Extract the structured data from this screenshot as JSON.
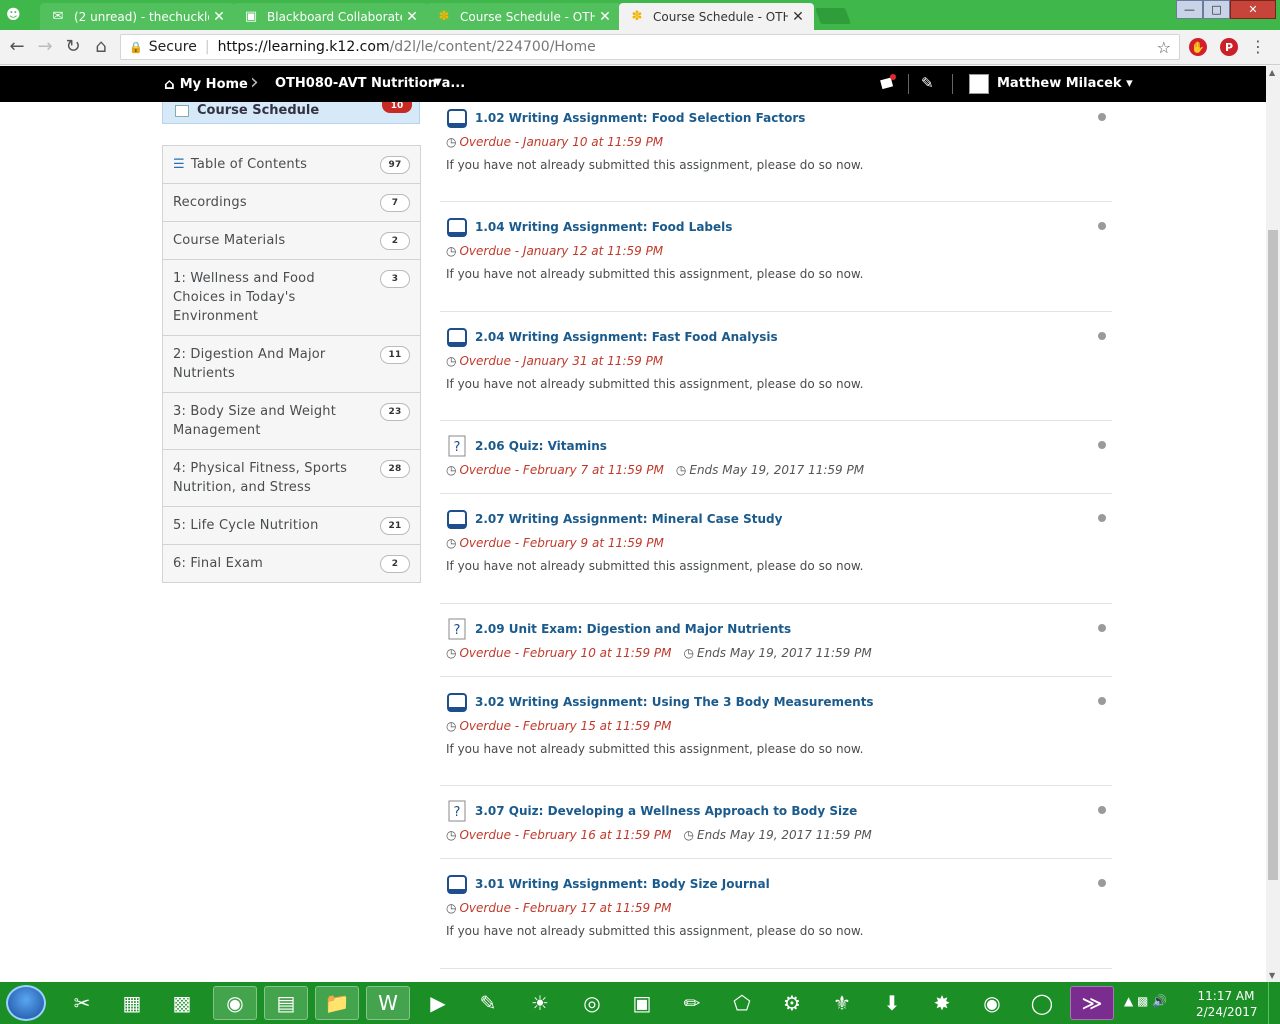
{
  "browser": {
    "tabs": [
      {
        "title": "(2 unread) - thechuckloo",
        "icon": "mail-icon"
      },
      {
        "title": "Blackboard Collaborate |",
        "icon": "video-icon"
      },
      {
        "title": "Course Schedule - OTH0",
        "icon": "d2l-icon"
      },
      {
        "title": "Course Schedule - OTH0",
        "icon": "d2l-icon"
      }
    ],
    "secure_label": "Secure",
    "url_host": "https://learning.k12.com",
    "url_path": "/d2l/le/content/224700/Home"
  },
  "navbar": {
    "home_label": "My Home",
    "course_label": "OTH080-AVT Nutrition a...",
    "user_name": "Matthew Milacek"
  },
  "sidebar": {
    "schedule_label": "Course Schedule",
    "schedule_badge": "10",
    "items": [
      {
        "label": "Table of Contents",
        "count": "97"
      },
      {
        "label": "Recordings",
        "count": "7"
      },
      {
        "label": "Course Materials",
        "count": "2"
      },
      {
        "label": "1: Wellness and Food Choices in Today's Environment",
        "count": "3"
      },
      {
        "label": "2: Digestion And Major Nutrients",
        "count": "11"
      },
      {
        "label": "3: Body Size and Weight Management",
        "count": "23"
      },
      {
        "label": "4: Physical Fitness, Sports Nutrition, and Stress",
        "count": "28"
      },
      {
        "label": "5: Life Cycle Nutrition",
        "count": "21"
      },
      {
        "label": "6: Final Exam",
        "count": "2"
      }
    ]
  },
  "entries": [
    {
      "type": "assignment",
      "title": "1.02 Writing Assignment: Food Selection Factors",
      "due": "Overdue - January 10 at 11:59 PM",
      "note": "If you have not already submitted this assignment, please do so now."
    },
    {
      "type": "assignment",
      "title": "1.04 Writing Assignment: Food Labels",
      "due": "Overdue - January 12 at 11:59 PM",
      "note": "If you have not already submitted this assignment, please do so now."
    },
    {
      "type": "assignment",
      "title": "2.04 Writing Assignment: Fast Food Analysis",
      "due": "Overdue - January 31 at 11:59 PM",
      "note": "If you have not already submitted this assignment, please do so now."
    },
    {
      "type": "quiz",
      "title": "2.06 Quiz: Vitamins",
      "due": "Overdue - February 7 at 11:59 PM",
      "ends": "Ends May 19, 2017 11:59 PM"
    },
    {
      "type": "assignment",
      "title": "2.07 Writing Assignment: Mineral Case Study",
      "due": "Overdue - February 9 at 11:59 PM",
      "note": "If you have not already submitted this assignment, please do so now."
    },
    {
      "type": "quiz",
      "title": "2.09 Unit Exam: Digestion and Major Nutrients",
      "due": "Overdue - February 10 at 11:59 PM",
      "ends": "Ends May 19, 2017 11:59 PM"
    },
    {
      "type": "assignment",
      "title": "3.02 Writing Assignment: Using The 3 Body Measurements",
      "due": "Overdue - February 15 at 11:59 PM",
      "note": "If you have not already submitted this assignment, please do so now."
    },
    {
      "type": "quiz",
      "title": "3.07 Quiz: Developing a Wellness Approach to Body Size",
      "due": "Overdue - February 16 at 11:59 PM",
      "ends": "Ends May 19, 2017 11:59 PM"
    },
    {
      "type": "assignment",
      "title": "3.01 Writing Assignment: Body Size Journal",
      "due": "Overdue - February 17 at 11:59 PM",
      "note": "If you have not already submitted this assignment, please do so now."
    }
  ],
  "taskbar": {
    "time": "11:17 AM",
    "date": "2/24/2017"
  },
  "colors": {
    "tab_strip": "#3fb74a",
    "overdue": "#c0392b",
    "link": "#1a5a8c",
    "taskbar": "#1b8f26"
  }
}
